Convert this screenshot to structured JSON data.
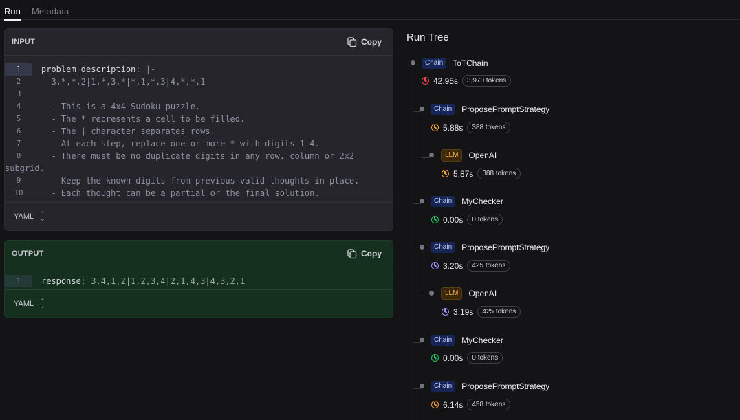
{
  "tabs": [
    {
      "label": "Run",
      "active": true
    },
    {
      "label": "Metadata",
      "active": false
    }
  ],
  "input": {
    "title": "INPUT",
    "copy_label": "Copy",
    "format": "YAML",
    "lines": [
      {
        "n": "1",
        "key": "problem_description",
        "rest": ": |-"
      },
      {
        "n": "2",
        "key": "",
        "rest": "  3,*,*,2|1,*,3,*|*,1,*,3|4,*,*,1"
      },
      {
        "n": "3",
        "key": "",
        "rest": ""
      },
      {
        "n": "4",
        "key": "",
        "rest": "  - This is a 4x4 Sudoku puzzle."
      },
      {
        "n": "5",
        "key": "",
        "rest": "  - The * represents a cell to be filled."
      },
      {
        "n": "6",
        "key": "",
        "rest": "  - The | character separates rows."
      },
      {
        "n": "7",
        "key": "",
        "rest": "  - At each step, replace one or more * with digits 1-4."
      },
      {
        "n": "8",
        "key": "",
        "rest": "  - There must be no duplicate digits in any row, column or 2x2 subgrid."
      },
      {
        "n": "9",
        "key": "",
        "rest": "  - Keep the known digits from previous valid thoughts in place."
      },
      {
        "n": "10",
        "key": "",
        "rest": "  - Each thought can be a partial or the final solution."
      }
    ]
  },
  "output": {
    "title": "OUTPUT",
    "copy_label": "Copy",
    "format": "YAML",
    "lines": [
      {
        "n": "1",
        "key": "response",
        "rest": ": 3,4,1,2|1,2,3,4|2,1,4,3|4,3,2,1"
      }
    ]
  },
  "run_tree": {
    "title": "Run Tree",
    "nodes": [
      {
        "type": "Chain",
        "name": "ToTChain",
        "time": "42.95s",
        "tokens": "3,970 tokens",
        "status_color": "#ef4444"
      },
      {
        "type": "Chain",
        "name": "ProposePromptStrategy",
        "time": "5.88s",
        "tokens": "388 tokens",
        "status_color": "#f0a030"
      },
      {
        "type": "LLM",
        "name": "OpenAI",
        "time": "5.87s",
        "tokens": "388 tokens",
        "status_color": "#f0a030"
      },
      {
        "type": "Chain",
        "name": "MyChecker",
        "time": "0.00s",
        "tokens": "0 tokens",
        "status_color": "#22c55e"
      },
      {
        "type": "Chain",
        "name": "ProposePromptStrategy",
        "time": "3.20s",
        "tokens": "425 tokens",
        "status_color": "#a78bfa"
      },
      {
        "type": "LLM",
        "name": "OpenAI",
        "time": "3.19s",
        "tokens": "425 tokens",
        "status_color": "#a78bfa"
      },
      {
        "type": "Chain",
        "name": "MyChecker",
        "time": "0.00s",
        "tokens": "0 tokens",
        "status_color": "#22c55e"
      },
      {
        "type": "Chain",
        "name": "ProposePromptStrategy",
        "time": "6.14s",
        "tokens": "458 tokens",
        "status_color": "#f0a030"
      }
    ]
  }
}
